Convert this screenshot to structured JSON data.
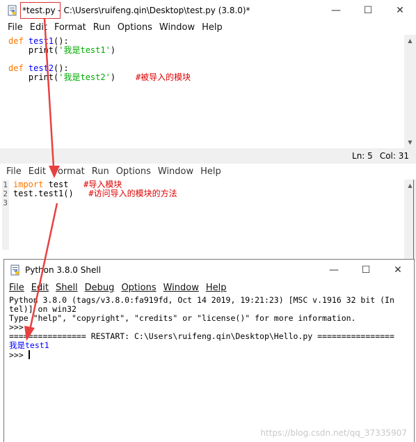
{
  "editor1": {
    "title": "*test.py - C:\\Users\\ruifeng.qin\\Desktop\\test.py (3.8.0)*",
    "menu": [
      "File",
      "Edit",
      "Format",
      "Run",
      "Options",
      "Window",
      "Help"
    ],
    "code": {
      "l1_kw": "def",
      "l1_fn": "test1",
      "l1_rest": "():",
      "l2_pre": "    print(",
      "l2_str": "'我是test1'",
      "l2_post": ")",
      "l4_kw": "def",
      "l4_fn": "test2",
      "l4_rest": "():",
      "l5_pre": "    print(",
      "l5_str": "'我是test2'",
      "l5_post": ")    ",
      "l5_cm": "#被导入的模块"
    },
    "status_ln": "Ln: 5",
    "status_col": "Col: 31"
  },
  "editor2": {
    "menu": [
      "File",
      "Edit",
      "Format",
      "Run",
      "Options",
      "Window",
      "Help"
    ],
    "gutter": [
      "1",
      "2",
      "3"
    ],
    "code": {
      "l1_kw": "import",
      "l1_rest": " test   ",
      "l1_cm": "#导入模块",
      "l2_text": "test.test1()   ",
      "l2_cm": "#访问导入的模块的方法"
    }
  },
  "shell": {
    "title": "Python 3.8.0 Shell",
    "menu": [
      "File",
      "Edit",
      "Shell",
      "Debug",
      "Options",
      "Window",
      "Help"
    ],
    "banner1": "Python 3.8.0 (tags/v3.8.0:fa919fd, Oct 14 2019, 19:21:23) [MSC v.1916 32 bit (In",
    "banner2": "tel)] on win32",
    "banner3": "Type \"help\", \"copyright\", \"credits\" or \"license()\" for more information.",
    "prompt": ">>> ",
    "restart": "================ RESTART: C:\\Users\\ruifeng.qin\\Desktop\\Hello.py ================",
    "output": "我是test1"
  },
  "watermark": "https://blog.csdn.net/qq_37335907"
}
